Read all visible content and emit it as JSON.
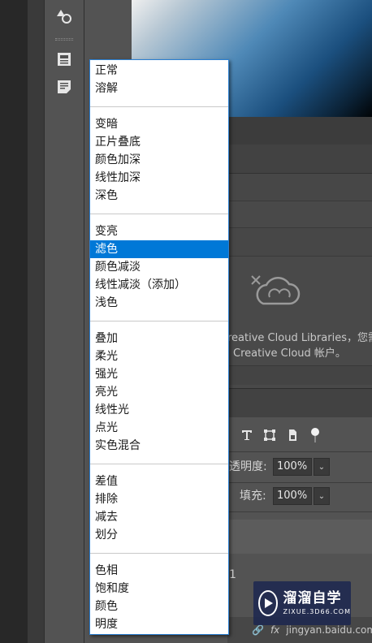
{
  "blend_menu": {
    "groups": [
      [
        "正常",
        "溶解"
      ],
      [
        "变暗",
        "正片叠底",
        "颜色加深",
        "线性加深",
        "深色"
      ],
      [
        "变亮",
        "滤色",
        "颜色减淡",
        "线性减淡（添加）",
        "浅色"
      ],
      [
        "叠加",
        "柔光",
        "强光",
        "亮光",
        "线性光",
        "点光",
        "实色混合"
      ],
      [
        "差值",
        "排除",
        "减去",
        "划分"
      ],
      [
        "色相",
        "饱和度",
        "颜色",
        "明度"
      ]
    ],
    "selected": "滤色"
  },
  "libraries": {
    "message_line1": "reative Cloud Libraries，您需要",
    "message_line2": "Creative Cloud 帐户。"
  },
  "layers": {
    "opacity_label": "透明度:",
    "opacity_value": "100%",
    "fill_label": "填充:",
    "fill_value": "100%",
    "row_partial": "1"
  },
  "bottom": {
    "link_text": "jingyan.baidu.com",
    "fx_label": "fx"
  },
  "watermark": {
    "title": "溜溜自学",
    "subtitle": "ZIXUE.3D66.COM"
  },
  "colors": {
    "selection": "#0078d7",
    "panel_bg": "#535353"
  }
}
